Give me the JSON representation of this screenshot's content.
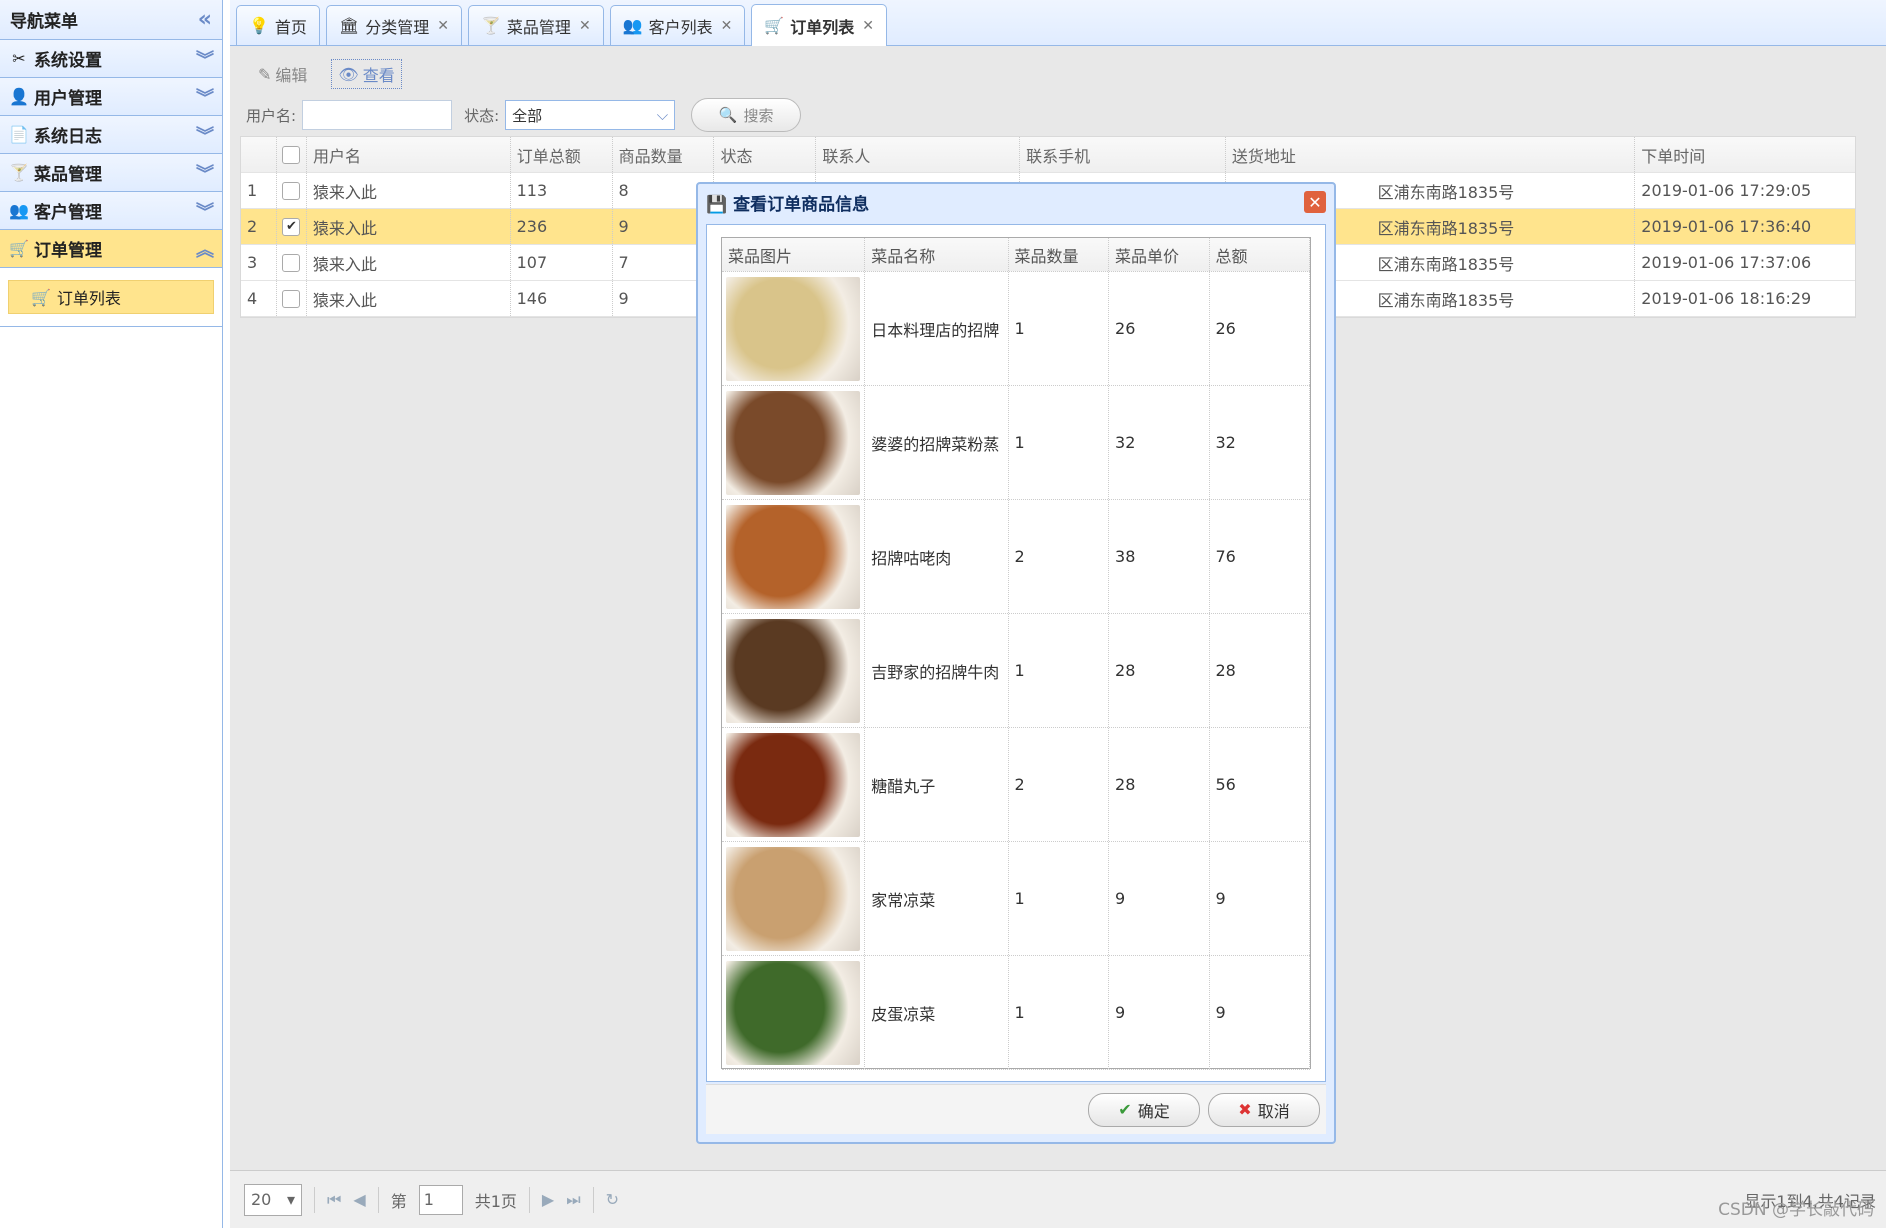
{
  "sidebar": {
    "title": "导航菜单",
    "items": [
      {
        "label": "系统设置"
      },
      {
        "label": "用户管理"
      },
      {
        "label": "系统日志"
      },
      {
        "label": "菜品管理"
      },
      {
        "label": "客户管理"
      },
      {
        "label": "订单管理"
      }
    ],
    "sub_item": "订单列表"
  },
  "tabs": [
    {
      "label": "首页"
    },
    {
      "label": "分类管理"
    },
    {
      "label": "菜品管理"
    },
    {
      "label": "客户列表"
    },
    {
      "label": "订单列表"
    }
  ],
  "toolbar": {
    "edit": "编辑",
    "view": "查看"
  },
  "filter": {
    "username_label": "用户名:",
    "status_label": "状态:",
    "status_value": "全部",
    "search": "搜索"
  },
  "grid": {
    "headers": [
      "用户名",
      "订单总额",
      "商品数量",
      "状态",
      "联系人",
      "联系手机",
      "送货地址",
      "下单时间"
    ],
    "rows": [
      {
        "num": "1",
        "user": "猿来入此",
        "total": "113",
        "qty": "8",
        "addr": "区浦东南路1835号",
        "time": "2019-01-06 17:29:05"
      },
      {
        "num": "2",
        "user": "猿来入此",
        "total": "236",
        "qty": "9",
        "addr": "区浦东南路1835号",
        "time": "2019-01-06 17:36:40"
      },
      {
        "num": "3",
        "user": "猿来入此",
        "total": "107",
        "qty": "7",
        "addr": "区浦东南路1835号",
        "time": "2019-01-06 17:37:06"
      },
      {
        "num": "4",
        "user": "猿来入此",
        "total": "146",
        "qty": "9",
        "addr": "区浦东南路1835号",
        "time": "2019-01-06 18:16:29"
      }
    ]
  },
  "pager": {
    "size": "20",
    "page_prefix": "第",
    "page": "1",
    "page_total": "共1页",
    "summary": "显示1到4,共4记录"
  },
  "dialog": {
    "title": "查看订单商品信息",
    "headers": [
      "菜品图片",
      "菜品名称",
      "菜品数量",
      "菜品单价",
      "总额"
    ],
    "items": [
      {
        "name": "日本料理店的招牌",
        "qty": "1",
        "price": "26",
        "total": "26",
        "color": "#d9c48a"
      },
      {
        "name": "婆婆的招牌菜粉蒸",
        "qty": "1",
        "price": "32",
        "total": "32",
        "color": "#7a4a2a"
      },
      {
        "name": "招牌咕咾肉",
        "qty": "2",
        "price": "38",
        "total": "76",
        "color": "#b4622a"
      },
      {
        "name": "吉野家的招牌牛肉",
        "qty": "1",
        "price": "28",
        "total": "28",
        "color": "#5a3a22"
      },
      {
        "name": "糖醋丸子",
        "qty": "2",
        "price": "28",
        "total": "56",
        "color": "#7a2a10"
      },
      {
        "name": "家常凉菜",
        "qty": "1",
        "price": "9",
        "total": "9",
        "color": "#c9a070"
      },
      {
        "name": "皮蛋凉菜",
        "qty": "1",
        "price": "9",
        "total": "9",
        "color": "#3f6a2a"
      }
    ],
    "ok": "确定",
    "cancel": "取消"
  },
  "watermark": "CSDN @学长敲代码"
}
